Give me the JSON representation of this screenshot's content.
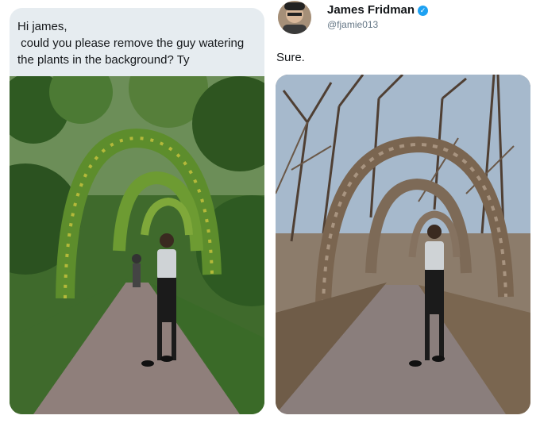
{
  "request": {
    "lines": [
      "Hi james,",
      " could you please remove the guy watering",
      "the plants in the background? Ty"
    ]
  },
  "reply": {
    "display_name": "James Fridman",
    "handle": "@fjamie013",
    "verified_icon": "verified-badge-icon",
    "text": "Sure."
  },
  "colors": {
    "bubble": "#e6ecf0",
    "verified": "#1da1f2",
    "handle": "#657786"
  }
}
